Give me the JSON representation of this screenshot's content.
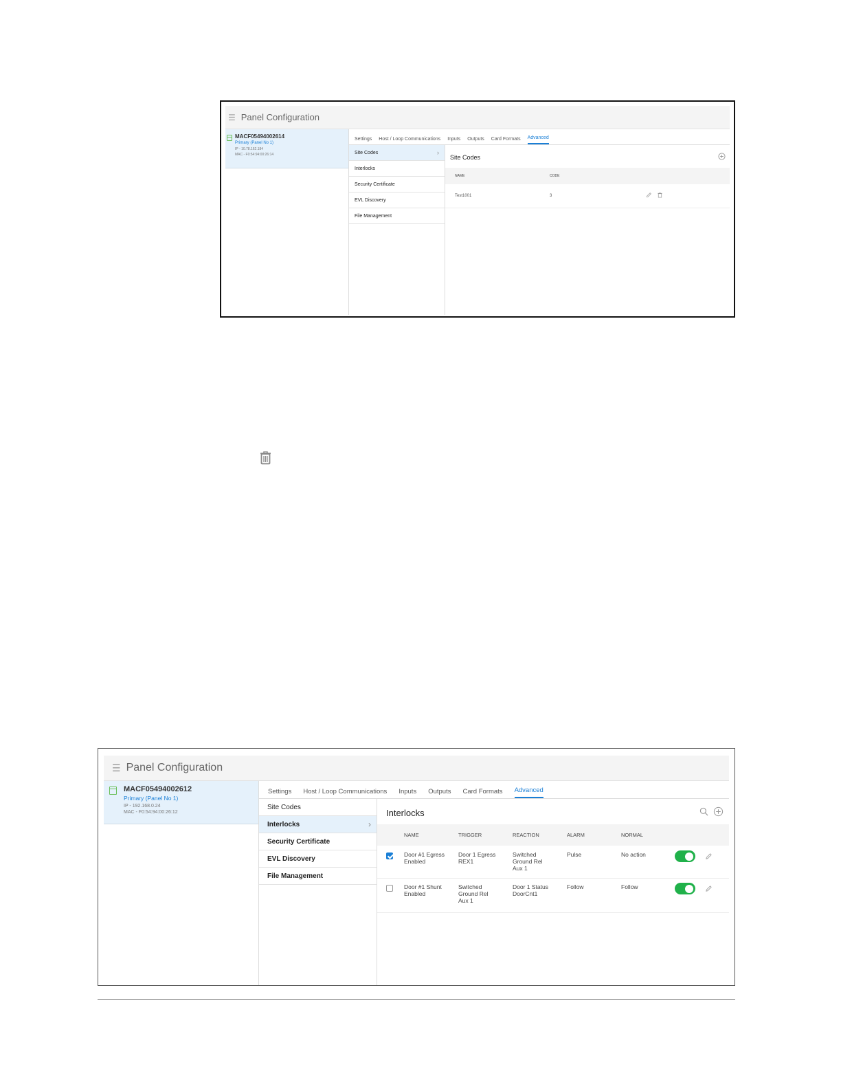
{
  "screen1": {
    "header": {
      "menu_icon": "hamburger-icon",
      "title": "Panel Configuration"
    },
    "panel": {
      "icon": "panel-icon",
      "name": "MACF05494002614",
      "role": "Primary (Panel No 1)",
      "ip": "IP - 10.78.162.184",
      "mac": "MAC - F0:54:94:00:26:14"
    },
    "tabs": [
      "Settings",
      "Host / Loop Communications",
      "Inputs",
      "Outputs",
      "Card Formats",
      "Advanced"
    ],
    "submenu": [
      "Site Codes",
      "Interlocks",
      "Security Certificate",
      "EVL Discovery",
      "File Management"
    ],
    "content": {
      "title": "Site Codes",
      "add_icon": "plus-circle-icon",
      "columns": [
        "NAME",
        "CODE"
      ],
      "rows": [
        {
          "name": "Test1001",
          "code": "3"
        }
      ]
    }
  },
  "standalone_icon": "trash-icon",
  "screen2": {
    "header": {
      "menu_icon": "hamburger-icon",
      "title": "Panel Configuration"
    },
    "panel": {
      "icon": "panel-icon",
      "name": "MACF05494002612",
      "role": "Primary (Panel No 1)",
      "ip": "IP - 192.168.0.24",
      "mac": "MAC - F0:54:94:00:26:12"
    },
    "tabs": [
      "Settings",
      "Host / Loop Communications",
      "Inputs",
      "Outputs",
      "Card Formats",
      "Advanced"
    ],
    "submenu": [
      "Site Codes",
      "Interlocks",
      "Security Certificate",
      "EVL Discovery",
      "File Management"
    ],
    "content": {
      "title": "Interlocks",
      "search_icon": "search-icon",
      "add_icon": "plus-circle-icon",
      "columns": [
        "NAME",
        "TRIGGER",
        "REACTION",
        "ALARM",
        "NORMAL"
      ],
      "rows": [
        {
          "checked": true,
          "name": "Door #1 Egress Enabled",
          "trigger": "Door 1 Egress REX1",
          "reaction": "Switched Ground Rel Aux 1",
          "alarm": "Pulse",
          "normal": "No action",
          "enabled": true
        },
        {
          "checked": false,
          "name": "Door #1 Shunt Enabled",
          "trigger": "Switched Ground Rel Aux 1",
          "reaction": "Door 1 Status DoorCnt1",
          "alarm": "Follow",
          "normal": "Follow",
          "enabled": true
        }
      ]
    }
  }
}
